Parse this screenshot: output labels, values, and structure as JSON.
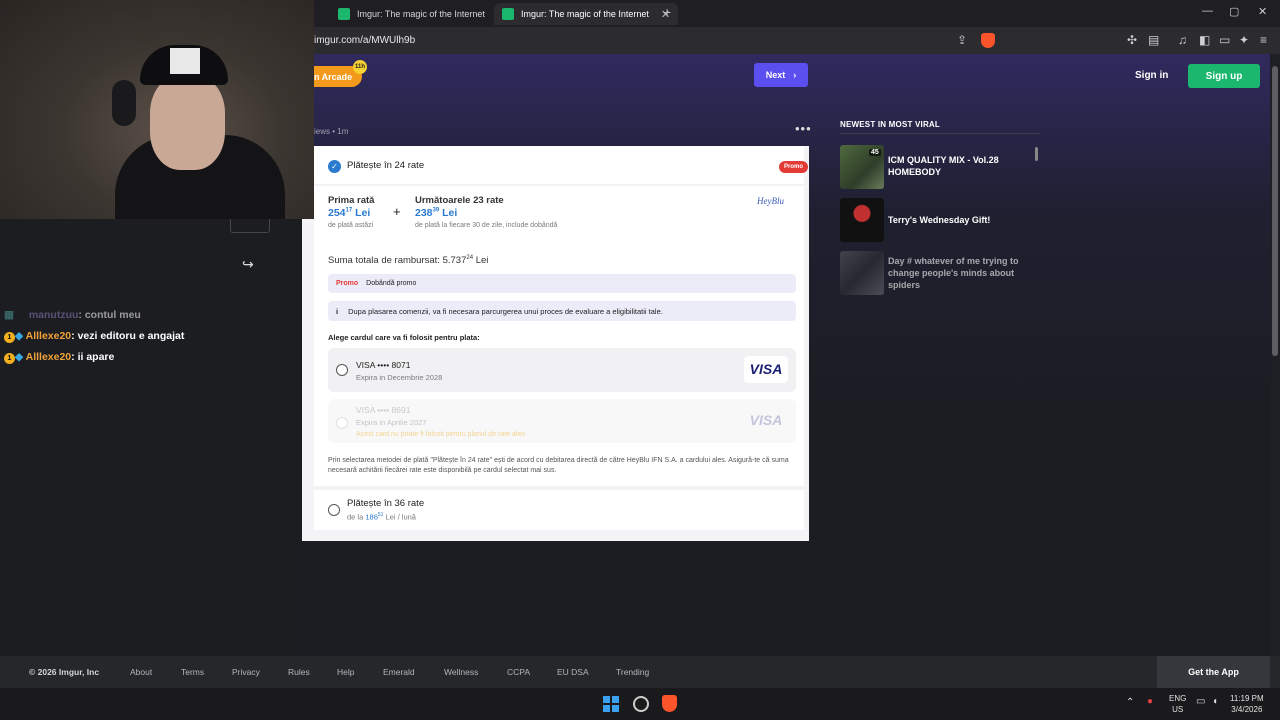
{
  "browser": {
    "tabs": [
      {
        "label": "Imgur: The magic of the Internet",
        "active": false
      },
      {
        "label": "Imgur: The magic of the Internet",
        "active": true
      }
    ],
    "url": "imgur.com/a/MWUlh9b"
  },
  "header": {
    "arcade_label": "n Arcade",
    "arcade_badge": "11h",
    "next_label": "Next",
    "signin_label": "Sign in",
    "signup_label": "Sign up"
  },
  "post": {
    "meta": "iews • 1m",
    "more_label": "•••"
  },
  "payment": {
    "plan24": {
      "label": "Plătește în 24 rate",
      "promo_badge": "Promo",
      "first_label": "Prima rată",
      "first_amount": "254",
      "first_decimals": "17",
      "first_currency": "Lei",
      "first_note": "de plată astăzi",
      "plus": "+",
      "next_label": "Următoarele 23 rate",
      "next_amount": "238",
      "next_decimals": "39",
      "next_currency": "Lei",
      "next_note": "de plată la fiecare 30 de zile, include dobândă",
      "provider": "HeyBlu",
      "total_label": "Suma totala de rambursat: 5.737",
      "total_decimals": "24",
      "total_currency": "Lei",
      "promo_tag": "Promo",
      "promo_text": "Dobândă promo",
      "info_icon": "i",
      "info_text": "Dupa plasarea comenzii, va fi necesara parcurgerea unui proces de evaluare a eligibilitatii tale.",
      "choose_card": "Alege cardul care va fi folosit pentru plata:",
      "cards": [
        {
          "label": "VISA •••• 8071",
          "expiry": "Expira in Decembrie 2028",
          "brand": "VISA",
          "warning": ""
        },
        {
          "label": "VISA •••• 8691",
          "expiry": "Expira in Aprilie 2027",
          "brand": "VISA",
          "warning": "Acest card nu poate fi folosit pentru planul de rate ales"
        }
      ],
      "consent": "Prin selectarea metodei de plată \"Plătește în 24 rate\" ești de acord cu debitarea directă de către HeyBlu IFN S.A. a cardului ales. Asigură-te că suma necesară achitării fiecărei rate este disponibilă pe cardul selectat mai sus."
    },
    "plan36": {
      "label": "Plătește în 36 rate",
      "from": "de la",
      "amount": "186",
      "decimals": "51",
      "suffix": "Lei / lună"
    }
  },
  "sidebar": {
    "title": "NEWEST IN MOST VIRAL",
    "items": [
      {
        "title": "ICM QUALITY MIX - Vol.28 HOMEBODY",
        "badge": "45"
      },
      {
        "title": "Terry's Wednesday Gift!",
        "badge": ""
      },
      {
        "title": "Day # whatever of me trying to change people's minds about spiders",
        "badge": ""
      }
    ]
  },
  "footer": {
    "copyright": "© 2026 Imgur, Inc",
    "links": [
      "About",
      "Terms",
      "Privacy",
      "Rules",
      "Help",
      "Emerald",
      "Wellness",
      "CCPA",
      "EU DSA",
      "Trending"
    ],
    "get_app": "Get the App"
  },
  "chat": {
    "messages": [
      {
        "user": "manutzuu",
        "text": "contul meu",
        "color": "#8a7fbf"
      },
      {
        "user": "Alllexe20",
        "text": "vezi editoru e angajat",
        "color": "#f2a23a"
      },
      {
        "user": "Alllexe20",
        "text": "ii apare",
        "color": "#f2a23a"
      }
    ]
  },
  "taskbar": {
    "lang_top": "ENG",
    "lang_bottom": "US",
    "time": "11:19 PM",
    "date": "3/4/2026"
  },
  "colors": {
    "imgur_green": "#1bb76e",
    "next_purple": "#5c4ff0",
    "arcade_orange": "#f39a1c",
    "pay_blue": "#2a7bd0",
    "promo_red": "#e43a35"
  }
}
